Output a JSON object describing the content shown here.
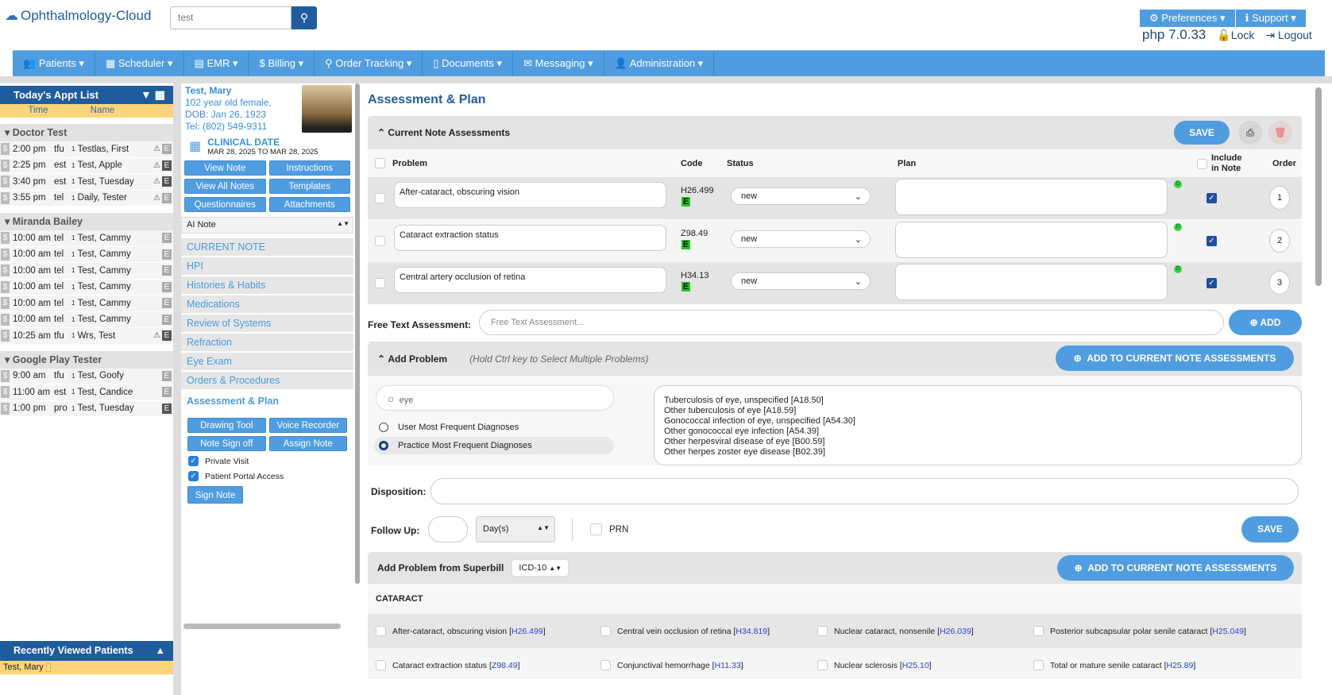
{
  "header": {
    "logo": "Ophthalmology-Cloud",
    "search_value": "test",
    "preferences": "Preferences",
    "support": "Support",
    "php": "php 7.0.33",
    "lock": "Lock",
    "logout": "Logout"
  },
  "nav": [
    "Patients",
    "Scheduler",
    "EMR",
    "Billing",
    "Order Tracking",
    "Documents",
    "Messaging",
    "Administration"
  ],
  "appt_list": {
    "title": "Today's Appt List",
    "col_time": "Time",
    "col_name": "Name",
    "groups": [
      {
        "name": "Doctor Test",
        "items": [
          {
            "time": "2:00 pm",
            "type": "tfu",
            "num": "1",
            "name": "Testlas, First"
          },
          {
            "time": "2:25 pm",
            "type": "est",
            "num": "1",
            "name": "Test, Apple"
          },
          {
            "time": "3:40 pm",
            "type": "est",
            "num": "1",
            "name": "Test, Tuesday"
          },
          {
            "time": "3:55 pm",
            "type": "tel",
            "num": "1",
            "name": "Daily, Tester"
          }
        ]
      },
      {
        "name": "Miranda Bailey",
        "items": [
          {
            "time": "10:00 am",
            "type": "tel",
            "num": "1",
            "name": "Test, Cammy"
          },
          {
            "time": "10:00 am",
            "type": "tel",
            "num": "1",
            "name": "Test, Cammy"
          },
          {
            "time": "10:00 am",
            "type": "tel",
            "num": "1",
            "name": "Test, Cammy"
          },
          {
            "time": "10:00 am",
            "type": "tel",
            "num": "1",
            "name": "Test, Cammy"
          },
          {
            "time": "10:00 am",
            "type": "tel",
            "num": "1",
            "name": "Test, Cammy"
          },
          {
            "time": "10:00 am",
            "type": "tel",
            "num": "1",
            "name": "Test, Cammy"
          },
          {
            "time": "10:25 am",
            "type": "tfu",
            "num": "1",
            "name": "Wrs, Test"
          }
        ]
      },
      {
        "name": "Google Play Tester",
        "items": [
          {
            "time": "9:00 am",
            "type": "tfu",
            "num": "1",
            "name": "Test, Goofy"
          },
          {
            "time": "11:00 am",
            "type": "est",
            "num": "1",
            "name": "Test, Candice"
          },
          {
            "time": "1:00 pm",
            "type": "pro",
            "num": "1",
            "name": "Test, Tuesday"
          }
        ]
      }
    ]
  },
  "recent": {
    "title": "Recently Viewed Patients",
    "item": "Test, Mary"
  },
  "patient": {
    "name": "Test, Mary",
    "age": "102 year old female,",
    "dob": "DOB: Jan 26, 1923",
    "tel": "Tel: (802) 549-9311",
    "clinical_label": "CLINICAL DATE",
    "clinical_range": "MAR 28, 2025 TO MAR 28, 2025"
  },
  "mid": {
    "buttons": [
      "View Note",
      "Instructions",
      "View All Notes",
      "Templates",
      "Questionnaires",
      "Attachments"
    ],
    "note_select": "AI Note",
    "menu": [
      "CURRENT NOTE",
      "HPI",
      "Histories & Habits",
      "Medications",
      "Review of Systems",
      "Refraction",
      "Eye Exam",
      "Orders & Procedures",
      "Assessment & Plan"
    ],
    "buttons2": [
      "Drawing Tool",
      "Voice Recorder",
      "Note Sign off",
      "Assign Note"
    ],
    "private_visit": "Private Visit",
    "portal": "Patient Portal Access",
    "sign": "Sign Note"
  },
  "main": {
    "title": "Assessment & Plan",
    "current_header": "Current Note Assessments",
    "save": "SAVE",
    "cols": {
      "problem": "Problem",
      "code": "Code",
      "status": "Status",
      "plan": "Plan",
      "include": "Include in Note",
      "order": "Order"
    },
    "rows": [
      {
        "problem": "After-cataract, obscuring vision",
        "code": "H26.499",
        "status": "new",
        "order": "1"
      },
      {
        "problem": "Cataract extraction status",
        "code": "Z98.49",
        "status": "new",
        "order": "2"
      },
      {
        "problem": "Central artery occlusion of retina",
        "code": "H34.13",
        "status": "new",
        "order": "3"
      }
    ],
    "free_label": "Free Text Assessment:",
    "free_placeholder": "Free Text Assessment...",
    "add": "ADD",
    "add_problem": "Add Problem",
    "hint": "(Hold Ctrl key to Select Multiple Problems)",
    "add_to": "ADD TO CURRENT NOTE ASSESSMENTS",
    "problem_search": "eye",
    "radio_user": "User Most Frequent Diagnoses",
    "radio_practice": "Practice Most Frequent Diagnoses",
    "results": [
      "Tuberculosis of eye, unspecified [A18.50]",
      "Other tuberculosis of eye [A18.59]",
      "Gonococcal infection of eye, unspecified [A54.30]",
      "Other gonococcal eye infection [A54.39]",
      "Other herpesviral disease of eye [B00.59]",
      "Other herpes zoster eye disease [B02.39]"
    ],
    "disposition": "Disposition:",
    "follow": "Follow Up:",
    "days": "Day(s)",
    "prn": "PRN",
    "superbill": "Add Problem from Superbill",
    "icd": "ICD-10",
    "category": "CATARACT",
    "sb": [
      [
        {
          "t": "After-cataract, obscuring vision",
          "c": "H26.499"
        },
        {
          "t": "Central vein occlusion of retina",
          "c": "H34.819"
        },
        {
          "t": "Nuclear cataract, nonsenile",
          "c": "H26.039"
        },
        {
          "t": "Posterior subcapsular polar senile cataract",
          "c": "H25.049"
        }
      ],
      [
        {
          "t": "Cataract extraction status",
          "c": "Z98.49"
        },
        {
          "t": "Conjunctival hemorrhage",
          "c": "H11.33"
        },
        {
          "t": "Nuclear sclerosis",
          "c": "H25.10"
        },
        {
          "t": "Total or mature senile cataract",
          "c": "H25.89"
        }
      ]
    ]
  }
}
